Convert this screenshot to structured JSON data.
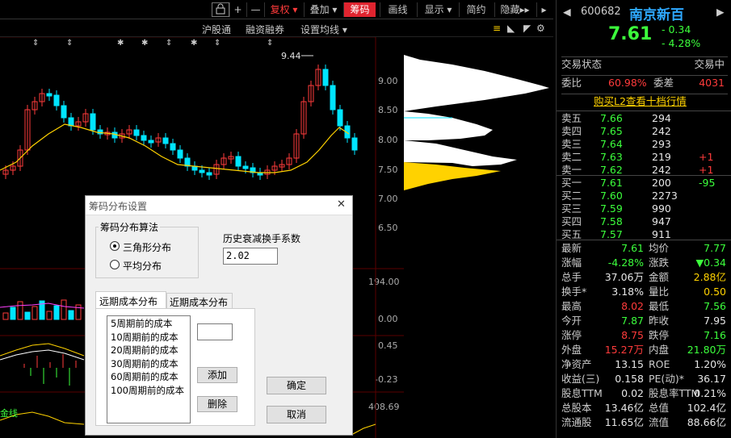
{
  "toolbar": {
    "lock_icon": "lock-icon",
    "plus": "+",
    "minus": "—",
    "fuquan": "复权",
    "diejia": "叠加",
    "chouma": "筹码",
    "huaxian": "画线",
    "xianshi": "显示",
    "jianyue": "简约",
    "yincang": "隐藏",
    "fast_forward": "▸▸",
    "arrow": "▸"
  },
  "subbar": {
    "hgt": "沪股通",
    "rzrq": "融资融券",
    "szjx": "设置均线"
  },
  "chart": {
    "high_label": "9.44",
    "price_ticks": [
      "9.00",
      "8.50",
      "8.00",
      "7.50",
      "7.00",
      "6.50"
    ],
    "vol_ticks": [
      "194.00",
      "0.00",
      "0.45",
      "-0.23",
      "408.69"
    ],
    "indicator_label": "金线"
  },
  "dialog": {
    "title": "筹码分布设置",
    "close": "✕",
    "algo_group": "筹码分布算法",
    "algo_triangle": "三角形分布",
    "algo_average": "平均分布",
    "decay_label": "历史衰减换手系数",
    "decay_value": "2.02",
    "tab_far": "远期成本分布",
    "tab_near": "近期成本分布",
    "list": [
      "5周期前的成本",
      "10周期前的成本",
      "20周期前的成本",
      "30周期前的成本",
      "60周期前的成本",
      "100周期前的成本"
    ],
    "add": "添加",
    "delete": "删除",
    "ok": "确定",
    "cancel": "取消"
  },
  "quote": {
    "code": "600682",
    "name": "南京新百",
    "price": "7.61",
    "change": "- 0.34",
    "change_pct": "- 4.28%",
    "status_label": "交易状态",
    "status_value": "交易中",
    "webi_label": "委比",
    "webi_value": "60.98%",
    "wecha_label": "委差",
    "wecha_value": "4031",
    "l2_link": "购买L2查看十档行情",
    "sells": [
      {
        "label": "卖五",
        "price": "7.66",
        "vol": "294",
        "delta": ""
      },
      {
        "label": "卖四",
        "price": "7.65",
        "vol": "242",
        "delta": ""
      },
      {
        "label": "卖三",
        "price": "7.64",
        "vol": "293",
        "delta": ""
      },
      {
        "label": "卖二",
        "price": "7.63",
        "vol": "219",
        "delta": "+1"
      },
      {
        "label": "卖一",
        "price": "7.62",
        "vol": "242",
        "delta": "+1"
      }
    ],
    "buys": [
      {
        "label": "买一",
        "price": "7.61",
        "vol": "200",
        "delta": "-95"
      },
      {
        "label": "买二",
        "price": "7.60",
        "vol": "2273",
        "delta": ""
      },
      {
        "label": "买三",
        "price": "7.59",
        "vol": "990",
        "delta": ""
      },
      {
        "label": "买四",
        "price": "7.58",
        "vol": "947",
        "delta": ""
      },
      {
        "label": "买五",
        "price": "7.57",
        "vol": "911",
        "delta": ""
      }
    ],
    "stats": [
      {
        "l1": "最新",
        "v1": "7.61",
        "c1": "green",
        "l2": "均价",
        "v2": "7.77",
        "c2": "green"
      },
      {
        "l1": "涨幅",
        "v1": "-4.28%",
        "c1": "green",
        "l2": "涨跌",
        "v2": "▼0.34",
        "c2": "green"
      },
      {
        "l1": "总手",
        "v1": "37.06万",
        "c1": "white",
        "l2": "金额",
        "v2": "2.88亿",
        "c2": "yellow"
      },
      {
        "l1": "换手*",
        "v1": "3.18%",
        "c1": "white",
        "l2": "量比",
        "v2": "0.50",
        "c2": "yellow"
      },
      {
        "l1": "最高",
        "v1": "8.02",
        "c1": "red",
        "l2": "最低",
        "v2": "7.56",
        "c2": "green"
      },
      {
        "l1": "今开",
        "v1": "7.87",
        "c1": "green",
        "l2": "昨收",
        "v2": "7.95",
        "c2": "white"
      },
      {
        "l1": "涨停",
        "v1": "8.75",
        "c1": "red",
        "l2": "跌停",
        "v2": "7.16",
        "c2": "green"
      },
      {
        "l1": "外盘",
        "v1": "15.27万",
        "c1": "red",
        "l2": "内盘",
        "v2": "21.80万",
        "c2": "green"
      },
      {
        "l1": "净资产",
        "v1": "13.15",
        "c1": "white",
        "l2": "ROE",
        "v2": "1.20%",
        "c2": "white"
      },
      {
        "l1": "收益(三)",
        "v1": "0.158",
        "c1": "white",
        "l2": "PE(动)*",
        "v2": "36.17",
        "c2": "white"
      },
      {
        "l1": "股息TTM",
        "v1": "0.02",
        "c1": "white",
        "l2": "股息率TTM",
        "v2": "0.21%",
        "c2": "white"
      },
      {
        "l1": "总股本",
        "v1": "13.46亿",
        "c1": "white",
        "l2": "总值",
        "v2": "102.4亿",
        "c2": "white"
      },
      {
        "l1": "流通股",
        "v1": "11.65亿",
        "c1": "white",
        "l2": "流值",
        "v2": "88.66亿",
        "c2": "white"
      }
    ]
  },
  "colors": {
    "up": "#ff3b3b",
    "down": "#3cff3c",
    "accent": "#e0242f",
    "chip": "#ffd200"
  }
}
